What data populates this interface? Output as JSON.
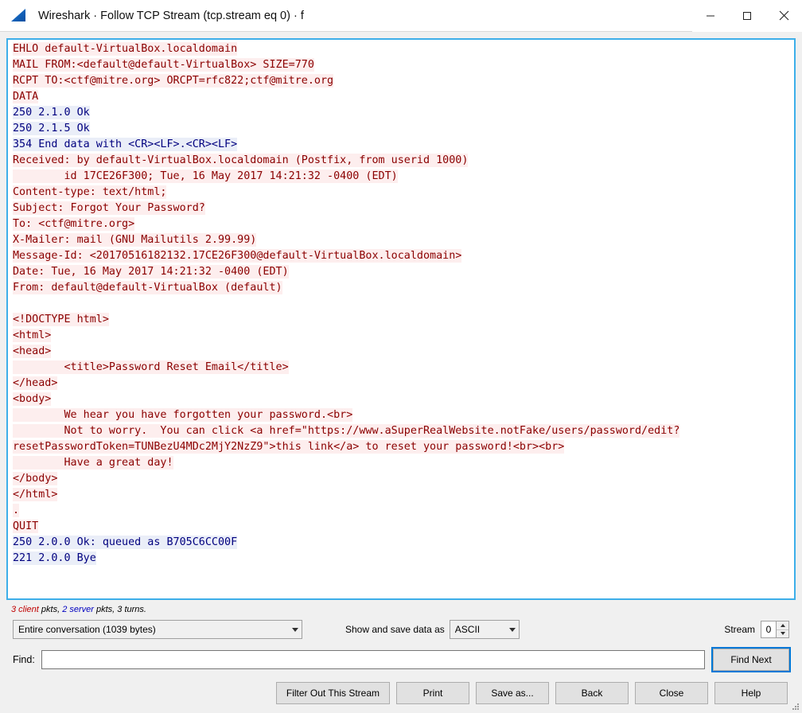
{
  "window": {
    "title": "Wireshark · Follow TCP Stream (tcp.stream eq 0) · f",
    "logo_name": "wireshark-shark-fin-logo",
    "minimize_label": "Minimize",
    "maximize_label": "Maximize",
    "close_label": "Close"
  },
  "stream": {
    "lines": [
      {
        "side": "client",
        "text": "EHLO default-VirtualBox.localdomain"
      },
      {
        "side": "client",
        "text": "MAIL FROM:<default@default-VirtualBox> SIZE=770"
      },
      {
        "side": "client",
        "text": "RCPT TO:<ctf@mitre.org> ORCPT=rfc822;ctf@mitre.org"
      },
      {
        "side": "client",
        "text": "DATA"
      },
      {
        "side": "server",
        "text": "250 2.1.0 Ok"
      },
      {
        "side": "server",
        "text": "250 2.1.5 Ok"
      },
      {
        "side": "server",
        "text": "354 End data with <CR><LF>.<CR><LF>"
      },
      {
        "side": "client",
        "text": "Received: by default-VirtualBox.localdomain (Postfix, from userid 1000)"
      },
      {
        "side": "client",
        "text": "        id 17CE26F300; Tue, 16 May 2017 14:21:32 -0400 (EDT)"
      },
      {
        "side": "client",
        "text": "Content-type: text/html;"
      },
      {
        "side": "client",
        "text": "Subject: Forgot Your Password?"
      },
      {
        "side": "client",
        "text": "To: <ctf@mitre.org>"
      },
      {
        "side": "client",
        "text": "X-Mailer: mail (GNU Mailutils 2.99.99)"
      },
      {
        "side": "client",
        "text": "Message-Id: <20170516182132.17CE26F300@default-VirtualBox.localdomain>"
      },
      {
        "side": "client",
        "text": "Date: Tue, 16 May 2017 14:21:32 -0400 (EDT)"
      },
      {
        "side": "client",
        "text": "From: default@default-VirtualBox (default)"
      },
      {
        "side": "blank",
        "text": ""
      },
      {
        "side": "client",
        "text": "<!DOCTYPE html>"
      },
      {
        "side": "client",
        "text": "<html>"
      },
      {
        "side": "client",
        "text": "<head>"
      },
      {
        "side": "client",
        "text": "        <title>Password Reset Email</title>"
      },
      {
        "side": "client",
        "text": "</head>"
      },
      {
        "side": "client",
        "text": "<body>"
      },
      {
        "side": "client",
        "text": "        We hear you have forgotten your password.<br>"
      },
      {
        "side": "client",
        "text": "        Not to worry.  You can click <a href=\"https://www.aSuperRealWebsite.notFake/users/password/edit?"
      },
      {
        "side": "client",
        "text": "resetPasswordToken=TUNBezU4MDc2MjY2NzZ9\">this link</a> to reset your password!<br><br>"
      },
      {
        "side": "client",
        "text": "        Have a great day!"
      },
      {
        "side": "client",
        "text": "</body>"
      },
      {
        "side": "client",
        "text": "</html>"
      },
      {
        "side": "client",
        "text": "."
      },
      {
        "side": "client",
        "text": "QUIT"
      },
      {
        "side": "server",
        "text": "250 2.0.0 Ok: queued as B705C6CC00F"
      },
      {
        "side": "server",
        "text": "221 2.0.0 Bye"
      }
    ],
    "colors": {
      "client_text": "#8b0000",
      "client_background": "#fdeeee",
      "server_text": "#00007f",
      "server_background": "#eaeef8",
      "focus_border": "#3daee9"
    }
  },
  "summary": {
    "client_part": "3 client",
    "client_suffix": " pkts, ",
    "server_part": "2 server",
    "server_suffix": " pkts, 3 turns."
  },
  "controls": {
    "conversation_selected": "Entire conversation (1039 bytes)",
    "conversation_options": [
      "Entire conversation (1039 bytes)"
    ],
    "show_save_label": "Show and save data as",
    "format_selected": "ASCII",
    "format_options": [
      "ASCII"
    ],
    "stream_label": "Stream",
    "stream_value": "0"
  },
  "find": {
    "label": "Find:",
    "value": "",
    "placeholder": "",
    "find_next_label": "Find Next"
  },
  "buttons": {
    "filter_out": "Filter Out This Stream",
    "print": "Print",
    "save_as": "Save as...",
    "back": "Back",
    "close": "Close",
    "help": "Help"
  }
}
